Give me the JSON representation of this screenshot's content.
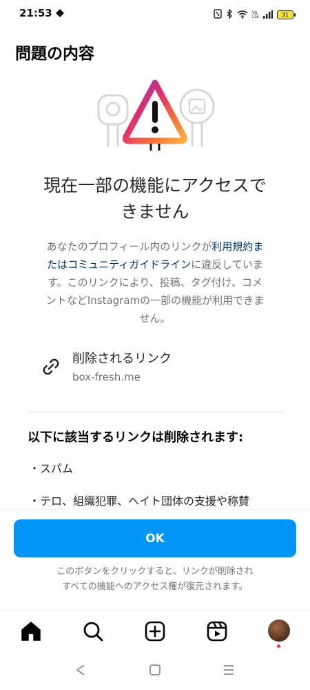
{
  "status_bar": {
    "time": "21:53",
    "battery_level": "31",
    "icons": [
      "nfc-icon",
      "bluetooth-icon",
      "wifi-icon",
      "volte-icon",
      "signal-icon",
      "battery-icon"
    ]
  },
  "page": {
    "title": "問題の内容"
  },
  "notice": {
    "heading_line1": "現在一部の機能にアクセスで",
    "heading_line2": "きません",
    "desc_part1": "あなたのプロフィール内のリンクが",
    "desc_link": "利用規約またはコミュニティガイドライン",
    "desc_part2": "に違反しています。このリンクにより、投稿、タグ付け、コメントなどInstagramの一部の機能が利用できません。"
  },
  "link": {
    "title": "削除されるリンク",
    "url": "box-fresh.me"
  },
  "removal": {
    "heading": "以下に該当するリンクは削除されます:",
    "items": [
      "・スパム",
      "・テロ、組織犯罪、ヘイト団体の支援や称賛"
    ]
  },
  "actions": {
    "ok_label": "OK",
    "footnote_line1": "このボタンをクリックすると、リンクが削除され",
    "footnote_line2": "すべての機能へのアクセス権が復元されます。"
  },
  "tabs": {
    "items": [
      "home-icon",
      "search-icon",
      "create-icon",
      "reels-icon",
      "profile-avatar"
    ]
  },
  "colors": {
    "primary_button": "#0095f6",
    "link_text": "#00376b",
    "secondary_text": "#737373",
    "notification_dot": "#ff3040"
  }
}
